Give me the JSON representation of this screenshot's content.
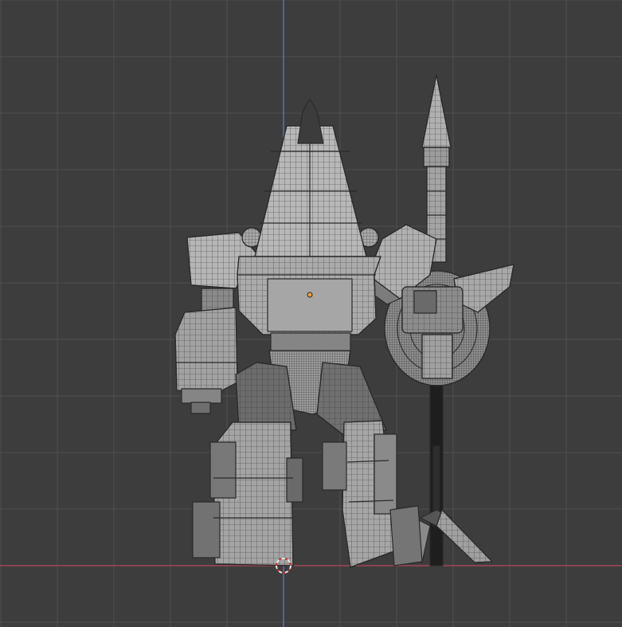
{
  "viewport": {
    "view": "front-orthographic",
    "shading": "solid-with-wireframe",
    "background_color": "#3d3d3d",
    "grid_line_color": "#4a4a4a",
    "grid_major_color": "#505050",
    "z_axis_color": "#5d7fc4",
    "x_axis_color": "#b5485a",
    "origin_color": "#f0a030",
    "cursor_color": "#e8e8e8",
    "mesh_fill": "#9a9a9a",
    "mesh_light": "#b4b4b4",
    "mesh_dark": "#5a5a5a",
    "mesh_edge": "#2a2a2a"
  },
  "scene": {
    "object": "robot-model",
    "parts": [
      "head-crest",
      "torso",
      "left-shoulder",
      "right-shoulder",
      "left-arm",
      "right-arm",
      "waist",
      "left-leg",
      "right-leg",
      "spear",
      "shield",
      "3d-cursor",
      "object-origin"
    ]
  }
}
